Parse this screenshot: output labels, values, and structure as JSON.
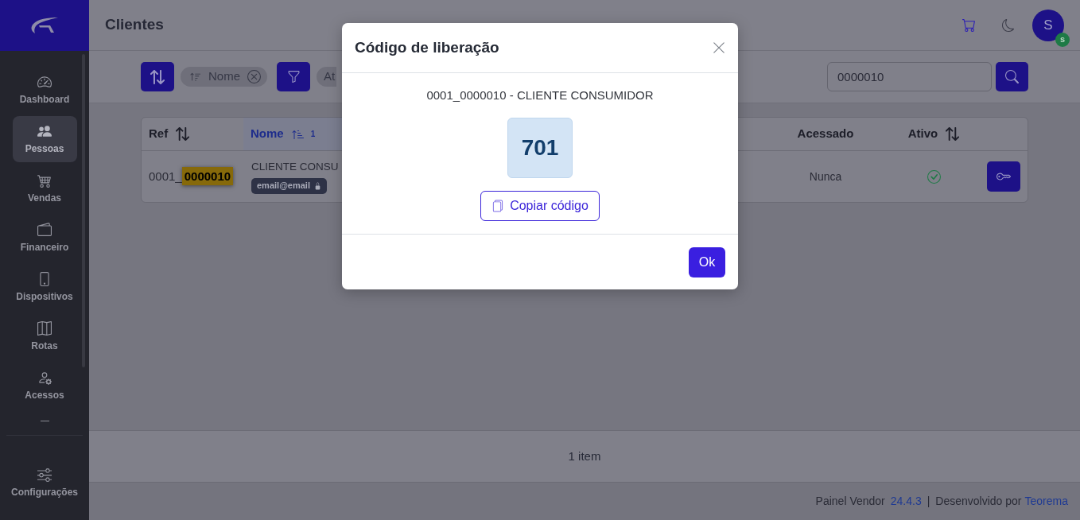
{
  "sidebar": {
    "items": [
      {
        "label": "Dashboard",
        "selected": false
      },
      {
        "label": "Pessoas",
        "selected": true
      },
      {
        "label": "Vendas",
        "selected": false
      },
      {
        "label": "Financeiro",
        "selected": false
      },
      {
        "label": "Dispositivos",
        "selected": false
      },
      {
        "label": "Rotas",
        "selected": false
      },
      {
        "label": "Acessos",
        "selected": false
      }
    ],
    "bottom_items": [
      {
        "label": "Configurações",
        "selected": false
      }
    ]
  },
  "header": {
    "title": "Clientes",
    "avatar": {
      "initial": "S",
      "badge": "s"
    }
  },
  "toolbar": {
    "sort_chips": [
      {
        "label": "Nome"
      }
    ],
    "filter_chips": [
      {
        "label": "At"
      }
    ],
    "search": {
      "value": "0000010"
    }
  },
  "table": {
    "columns": [
      {
        "label": "Ref",
        "sorted": false
      },
      {
        "label": "Nome",
        "sorted": true,
        "sort_order": "1"
      },
      {
        "label": "Acessado"
      },
      {
        "label": "Ativo",
        "sorted": false
      }
    ],
    "rows": [
      {
        "ref": "0001_**0000010**",
        "name": "CLIENTE CONSU",
        "email": "email@email",
        "email_locked": true,
        "accessed": "Nunca",
        "active": true
      }
    ]
  },
  "footer": {
    "count": "1 item"
  },
  "status_bar": {
    "app": "Painel Vendor",
    "version": "24.4.3",
    "separator": "|",
    "credit": "Desenvolvido por",
    "company": "Teorema"
  },
  "modal": {
    "title": "Código de liberação",
    "subject": "0001_0000010 - CLIENTE CONSUMIDOR",
    "code": "701",
    "copy_button": "Copiar código",
    "ok_button": "Ok"
  }
}
